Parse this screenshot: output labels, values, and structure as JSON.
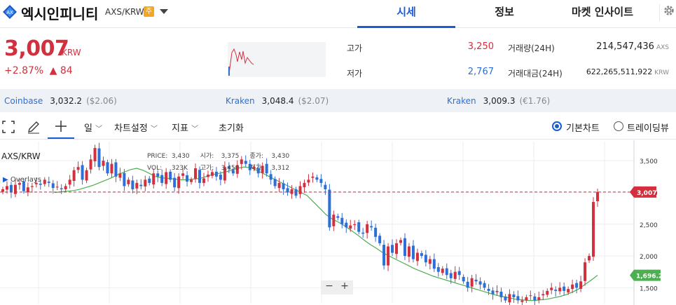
{
  "header": {
    "coin_name": "엑시인피니티",
    "pair": "AXS/KRW",
    "badge": "주",
    "tabs": [
      "시세",
      "정보",
      "마켓 인사이트"
    ]
  },
  "price": {
    "current": "3,007",
    "unit": "KRW",
    "change_pct": "+2.87%",
    "change_abs": "▲ 84"
  },
  "stats": {
    "high_label": "고가",
    "high": "3,250",
    "low_label": "저가",
    "low": "2,767",
    "volume_label": "거래량(24H)",
    "volume": "214,547,436",
    "volume_unit": "AXS",
    "amount_label": "거래대금(24H)",
    "amount": "622,265,511,922",
    "amount_unit": "KRW"
  },
  "exchanges": [
    {
      "name": "Coinbase",
      "price": "3,032.2",
      "sub": "($2.06)"
    },
    {
      "name": "Kraken",
      "price": "3,048.4",
      "sub": "($2.07)"
    },
    {
      "name": "Kraken",
      "price": "3,009.3",
      "sub": "(€1.76)"
    }
  ],
  "toolbar": {
    "interval": "일",
    "chart_settings": "차트설정",
    "indicators": "지표",
    "reset": "초기화",
    "basic_chart": "기본차트",
    "tradingview": "트레이딩뷰"
  },
  "chart_info": {
    "pair": "AXS/KRW",
    "overlays": "Overlays",
    "price_label": "PRICE:",
    "price_val": "3,430",
    "open_label": "시가:",
    "open_val": "3,375",
    "close_label": "종가:",
    "close_val": "3,430",
    "vol_label": "VOL:",
    "vol_val": "323K",
    "high_label": "고가:",
    "high_val": "3,450",
    "low_label": "저가:",
    "low_val": "3,312",
    "current_tag": "3,007",
    "ma_tag": "1,696.2",
    "zoom_out": "−",
    "zoom_in": "+"
  },
  "chart_data": {
    "type": "candlestick",
    "y_ticks": [
      3500,
      3000,
      2500,
      2000,
      1500
    ],
    "y_tick_labels": [
      "3,500",
      "3,000",
      "2,500",
      "2,000",
      "1,500"
    ],
    "ylim": [
      1250,
      3800
    ],
    "current_price": 3007,
    "ma_last": 1696.2,
    "closes": [
      3050,
      3100,
      3000,
      3120,
      3150,
      3020,
      3080,
      3100,
      3150,
      3120,
      3200,
      3150,
      3070,
      3090,
      3050,
      3100,
      3200,
      3350,
      3400,
      3200,
      3350,
      3520,
      3700,
      3400,
      3500,
      3300,
      3450,
      3250,
      3300,
      3100,
      3200,
      3050,
      3150,
      3100,
      3200,
      3150,
      3300,
      3250,
      3150,
      3320,
      3200,
      3080,
      3250,
      3300,
      3170,
      3200,
      3380,
      3150,
      3220,
      3280,
      3320,
      3250,
      3200,
      3400,
      3380,
      3300,
      3430,
      3520,
      3450,
      3350,
      3400,
      3300,
      3420,
      3300,
      3200,
      3100,
      3150,
      3050,
      3000,
      3050,
      2950,
      3100,
      3150,
      3200,
      3250,
      3200,
      3150,
      3050,
      2450,
      2650,
      2600,
      2500,
      2450,
      2480,
      2500,
      2380,
      2350,
      2500,
      2450,
      2300,
      2200,
      1850,
      2150,
      2050,
      2200,
      2250,
      2000,
      2150,
      1950,
      2050,
      2000,
      1900,
      1950,
      1800,
      1750,
      1800,
      1700,
      1650,
      1750,
      1700,
      1600,
      1500,
      1650,
      1600,
      1550,
      1500,
      1450,
      1400,
      1450,
      1350,
      1300,
      1400,
      1350,
      1300,
      1300,
      1350,
      1380,
      1300,
      1350,
      1400,
      1450,
      1500,
      1450,
      1500,
      1450,
      1480,
      1550,
      1500,
      1600,
      1900,
      2000,
      2850,
      3007
    ],
    "ma": [
      3000,
      3010,
      3020,
      3030,
      3050,
      3080,
      3110,
      3150,
      3190,
      3230,
      3280,
      3320,
      3360,
      3380,
      3350,
      3300,
      3250,
      3230,
      3220,
      3210,
      3200,
      3200,
      3210,
      3220,
      3250,
      3280,
      3300,
      3320,
      3350,
      3380,
      3400,
      3390,
      3350,
      3300,
      3250,
      3200,
      3150,
      3100,
      3050,
      3000,
      2950,
      2850,
      2750,
      2650,
      2580,
      2530,
      2470,
      2400,
      2330,
      2250,
      2180,
      2120,
      2050,
      2000,
      1950,
      1900,
      1850,
      1800,
      1760,
      1720,
      1680,
      1650,
      1620,
      1590,
      1560,
      1530,
      1500,
      1470,
      1440,
      1410,
      1380,
      1360,
      1340,
      1320,
      1310,
      1300,
      1300,
      1310,
      1320,
      1340,
      1360,
      1390,
      1430,
      1480,
      1550,
      1620,
      1696.2
    ]
  }
}
